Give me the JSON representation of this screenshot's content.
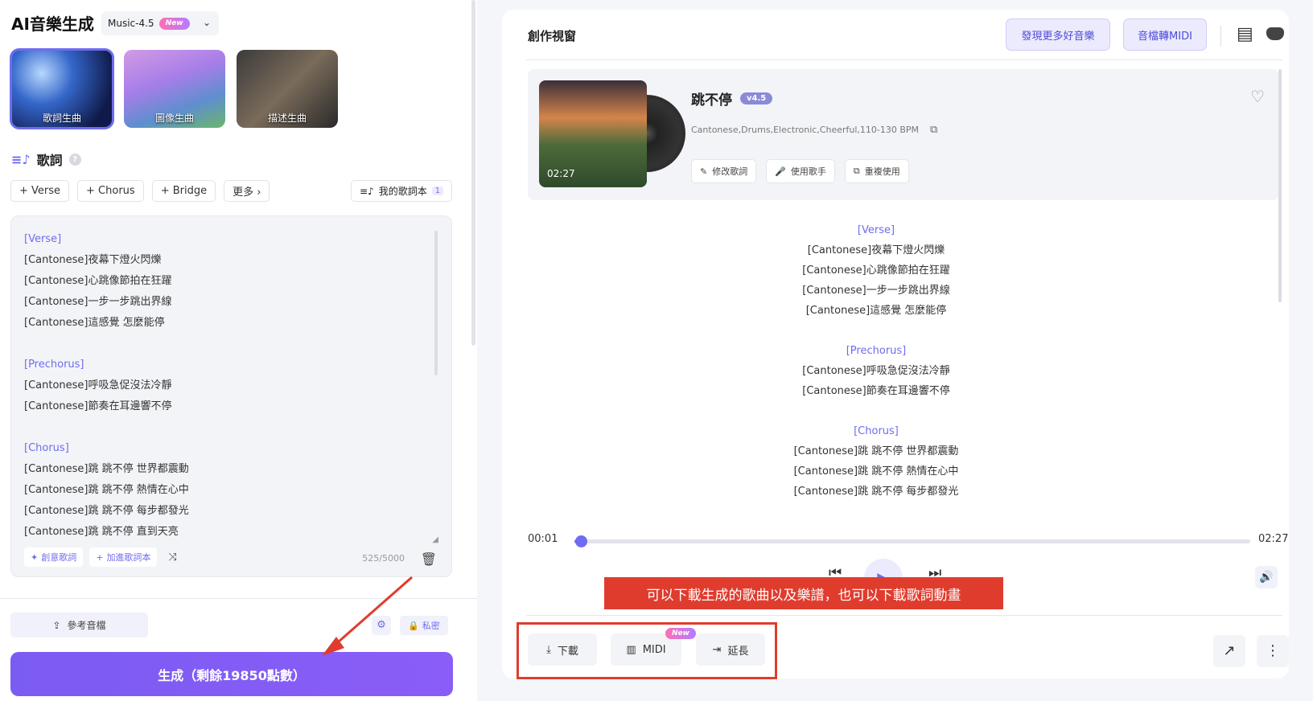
{
  "brand": "AI音樂生成",
  "model": {
    "name": "Music-4.5",
    "badge": "New"
  },
  "modes": [
    {
      "label": "歌詞生曲"
    },
    {
      "label": "圖像生曲"
    },
    {
      "label": "描述生曲"
    }
  ],
  "lyrics_section": {
    "title": "歌詞",
    "tag_buttons": [
      "+ Verse",
      "+ Chorus",
      "+ Bridge",
      "更多 ›"
    ],
    "my_book": {
      "label": "我的歌詞本",
      "count": "1"
    },
    "lines": [
      {
        "t": "[Verse]",
        "sec": true
      },
      {
        "t": "[Cantonese]夜幕下燈火閃爍"
      },
      {
        "t": "[Cantonese]心跳像節拍在狂躍"
      },
      {
        "t": "[Cantonese]一步一步跳出界線"
      },
      {
        "t": "[Cantonese]這感覺 怎麼能停"
      },
      {
        "t": "",
        "gap": true
      },
      {
        "t": "[Prechorus]",
        "sec": true
      },
      {
        "t": "[Cantonese]呼吸急促沒法冷靜"
      },
      {
        "t": "[Cantonese]節奏在耳邊響不停"
      },
      {
        "t": "",
        "gap": true
      },
      {
        "t": "[Chorus]",
        "sec": true
      },
      {
        "t": "[Cantonese]跳 跳不停 世界都震動"
      },
      {
        "t": "[Cantonese]跳 跳不停 熱情在心中"
      },
      {
        "t": "[Cantonese]跳 跳不停 每步都發光"
      },
      {
        "t": "[Cantonese]跳 跳不停 直到天亮"
      }
    ],
    "tools": {
      "creative": "創意歌詞",
      "add_book": "加進歌詞本"
    },
    "char_count": "525/5000"
  },
  "bottom_left": {
    "ref_audio": "參考音檔",
    "private": "私密",
    "generate": "生成（剩餘19850點數）"
  },
  "right": {
    "title": "創作視窗",
    "discover": "發現更多好音樂",
    "midi": "音檔轉MIDI",
    "song": {
      "title": "跳不停",
      "version": "v4.5",
      "tags": "Cantonese,Drums,Electronic,Cheerful,110-130 BPM",
      "duration": "02:27",
      "buttons": [
        "修改歌詞",
        "使用歌手",
        "重複使用"
      ]
    },
    "lyrics": [
      {
        "t": "[Verse]",
        "sec": true
      },
      {
        "t": "[Cantonese]夜幕下燈火閃爍"
      },
      {
        "t": "[Cantonese]心跳像節拍在狂躍"
      },
      {
        "t": "[Cantonese]一步一步跳出界線"
      },
      {
        "t": "[Cantonese]這感覺 怎麼能停"
      },
      {
        "t": "",
        "gap": true
      },
      {
        "t": "[Prechorus]",
        "sec": true
      },
      {
        "t": "[Cantonese]呼吸急促沒法冷靜"
      },
      {
        "t": "[Cantonese]節奏在耳邊響不停"
      },
      {
        "t": "",
        "gap": true
      },
      {
        "t": "[Chorus]",
        "sec": true
      },
      {
        "t": "[Cantonese]跳 跳不停 世界都震動"
      },
      {
        "t": "[Cantonese]跳 跳不停 熱情在心中"
      },
      {
        "t": "[Cantonese]跳 跳不停 每步都發光"
      }
    ],
    "player": {
      "current": "00:01",
      "total": "02:27",
      "progress": 0.01
    },
    "callout": "可以下載生成的歌曲以及樂譜，也可以下載歌詞動畫",
    "actions": {
      "download": "下載",
      "midi": "MIDI",
      "midi_badge": "New",
      "extend": "延長"
    }
  },
  "colors": {
    "accent": "#6f6cf0",
    "annotation": "#e03c2e"
  }
}
